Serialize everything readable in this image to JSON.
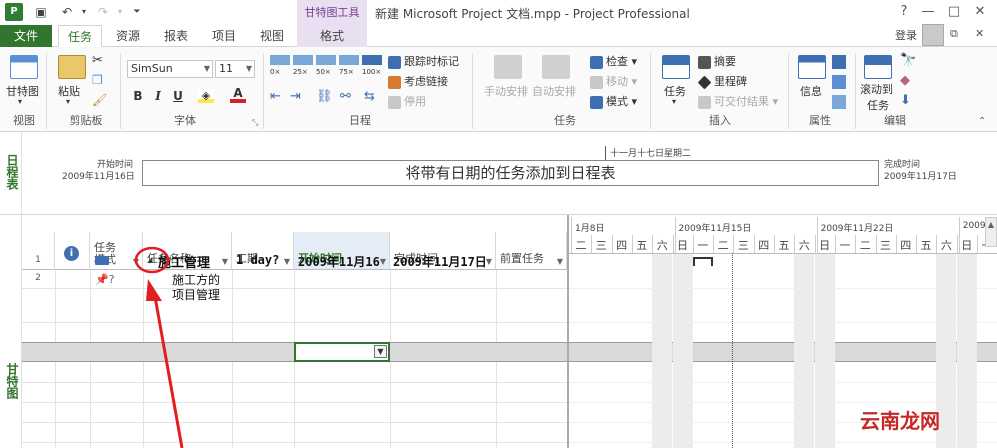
{
  "window": {
    "title": "新建 Microsoft Project 文档.mpp - Project Professional",
    "context_tab_group": "甘特图工具",
    "help": "?",
    "minimize": "—",
    "restore": "□",
    "close": "✕",
    "login": "登录"
  },
  "tabs": {
    "file": "文件",
    "task": "任务",
    "resource": "资源",
    "report": "报表",
    "project": "项目",
    "view": "视图",
    "format": "格式"
  },
  "ribbon": {
    "view_group": {
      "label": "视图",
      "gantt": "甘特图"
    },
    "clipboard_group": {
      "label": "剪贴板",
      "paste": "粘贴"
    },
    "font_group": {
      "label": "字体",
      "font_name": "SimSun",
      "font_size": "11",
      "bold": "B",
      "italic": "I",
      "underline": "U"
    },
    "schedule_group": {
      "label": "日程",
      "pct": [
        "0×",
        "25×",
        "50×",
        "75×",
        "100×"
      ],
      "track": "跟踪时标记",
      "respect_links": "考虑链接",
      "inactivate": "停用"
    },
    "tasks_group": {
      "label": "任务",
      "manual": "手动安排",
      "auto": "自动安排",
      "inspect": "检查",
      "move": "移动",
      "mode": "模式"
    },
    "insert_group": {
      "label": "插入",
      "task": "任务",
      "summary": "摘要",
      "milestone": "里程碑",
      "deliverable": "可交付结果"
    },
    "properties_group": {
      "label": "属性",
      "info": "信息"
    },
    "editing_group": {
      "label": "编辑",
      "scroll_to": "滚动到",
      "scroll_to2": "任务"
    }
  },
  "timeline": {
    "side_label": "日程表",
    "start_label": "开始时间",
    "start_date": "2009年11月16日",
    "finish_label": "完成时间",
    "finish_date": "2009年11月17日",
    "today_label": "十一月十七日星期二",
    "placeholder": "将带有日期的任务添加到日程表"
  },
  "grid": {
    "side_label": "甘特图",
    "headers": {
      "info": "ℹ",
      "mode": "任务模式",
      "name": "任务名称",
      "duration": "工期",
      "start": "开始时间",
      "finish": "完成时间",
      "pred": "前置任务"
    },
    "rows": [
      {
        "num": "1",
        "name": "施工管理",
        "collapse": "◢",
        "duration": "1 day?",
        "start": "2009年11月16",
        "finish": "2009年11月17日"
      },
      {
        "num": "2",
        "name_line1": "施工方的",
        "name_line2": "项目管理"
      }
    ]
  },
  "gantt": {
    "weeks": [
      "1月8日",
      "2009年11月15日",
      "2009年11月22日",
      "2009"
    ],
    "days": [
      "二",
      "三",
      "四",
      "五",
      "六",
      "日",
      "一",
      "二",
      "三",
      "四",
      "五",
      "六",
      "日",
      "一",
      "二",
      "三",
      "四",
      "五",
      "六",
      "日",
      "一"
    ]
  },
  "watermark": "云南龙网",
  "colors": {
    "accent": "#31752f",
    "ctx": "#7a3f98",
    "annotation": "#e02020"
  }
}
